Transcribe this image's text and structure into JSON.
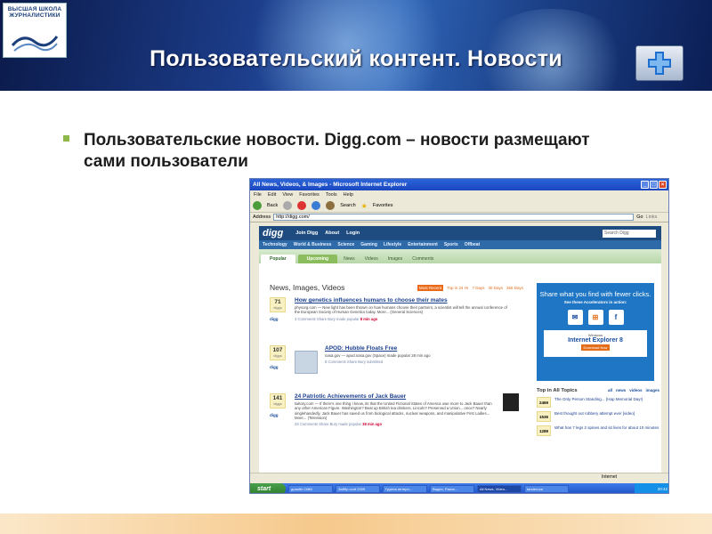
{
  "slide": {
    "logo_text": "ВЫСШАЯ ШКОЛА ЖУРНАЛИСТИКИ",
    "title": "Пользовательский контент. Новости",
    "bullet": "Пользовательские новости. Digg.com – новости размещают сами пользователи"
  },
  "browser": {
    "window_title": "All News, Videos, & Images - Microsoft Internet Explorer",
    "menu": [
      "File",
      "Edit",
      "View",
      "Favorites",
      "Tools",
      "Help"
    ],
    "toolbar": [
      "Back",
      "Search",
      "Favorites"
    ],
    "address_label": "Address",
    "address_url": "http://digg.com/",
    "go_label": "Go",
    "links_label": "Links",
    "status_zone": "Internet"
  },
  "digg": {
    "logo": "digg",
    "nav": [
      "Join Digg",
      "About",
      "Login"
    ],
    "search_placeholder": "Search Digg",
    "categories": [
      "Technology",
      "World & Business",
      "Science",
      "Gaming",
      "Lifestyle",
      "Entertainment",
      "Sports",
      "Offbeat"
    ],
    "tabs": [
      "Popular",
      "Upcoming"
    ],
    "subtabs": [
      "News",
      "Videos",
      "Images",
      "Comments"
    ],
    "section_title": "News, Images, Videos",
    "sort_selected": "Most Recent",
    "sort_options": [
      "Top in 24 Hr",
      "7 Days",
      "30 Days",
      "365 Days"
    ],
    "stories": [
      {
        "diggs": "71",
        "diggs_label": "diggs",
        "digg_link": "digg",
        "title": "How genetics influences humans to choose their mates",
        "desc": "physorg.com — New light has been thrown on how humans choose their partners, a scientist will tell the annual conference of the European Society of Human Genetics today. More... (General Sciences)",
        "meta": "3 Comments   Share   Bury   made popular",
        "time": "8 min ago"
      },
      {
        "diggs": "107",
        "diggs_label": "diggs",
        "digg_link": "digg",
        "title": "APOD: Hubble Floats Free",
        "desc": "nasa.gov — apod.nasa.gov (Space) made popular 28 min ago",
        "meta": "8 Comments   Share   Bury   submitted",
        "time": ""
      },
      {
        "diggs": "141",
        "diggs_label": "diggs",
        "digg_link": "digg",
        "title": "24 Patriotic Achievements of Jack Bauer",
        "desc": "twitory.com — If there's one thing I know, its that the United Fictional States of America owe more to Jack Bauer than any other American Figure. Washington? Beat up British tea drinkers. Lincoln? Preserved a Union... once? Nearly singlehandedly, Jack Bauer has saved us from biological attacks, nuclear weapons, and manipulative First Ladies... More... (Television)",
        "meta": "28 Comments   Share   Bury   made popular",
        "time": "38 min ago"
      }
    ],
    "ad": {
      "headline": "Share what you find with fewer clicks.",
      "sub": "See these Accelerators in action:",
      "windows_label": "Windows",
      "product": "Internet Explorer 8",
      "download": "Download Now"
    },
    "topics": {
      "title": "Top in All Topics",
      "filters": [
        "all",
        "news",
        "videos",
        "images"
      ],
      "items": [
        {
          "count": "2469",
          "text": "The Only Person Standing... (Hap Memorial Day!)"
        },
        {
          "count": "1536",
          "text": "Best thought out robbery attempt ever [video]"
        },
        {
          "count": "1289",
          "text": "What has 7 legs 2 spines and sit lives for about 10 minutes"
        }
      ]
    },
    "taskbar": {
      "start": "start",
      "items": [
        "дизайн CMM",
        "Заббр conf 2009",
        "Группа интерн...",
        "Видео, Разно...",
        "All News, Video...",
        "tanderova"
      ],
      "clock": "20:42"
    }
  }
}
